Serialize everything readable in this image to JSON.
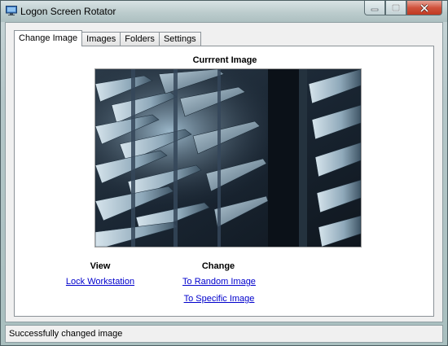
{
  "window": {
    "title": "Logon Screen Rotator"
  },
  "tabs": [
    {
      "label": "Change Image",
      "active": true
    },
    {
      "label": "Images",
      "active": false
    },
    {
      "label": "Folders",
      "active": false
    },
    {
      "label": "Settings",
      "active": false
    }
  ],
  "current_image": {
    "heading": "Currrent Image"
  },
  "view": {
    "heading": "View",
    "lock_link": "Lock Workstation"
  },
  "change": {
    "heading": "Change",
    "random_link": "To Random Image",
    "specific_link": "To Specific Image"
  },
  "status": {
    "text": "Successfully changed image"
  },
  "icons": {
    "app": "monitor-icon",
    "minimize": "minimize-icon",
    "maximize": "maximize-icon",
    "close": "close-icon"
  },
  "colors": {
    "link": "#0000cc",
    "close_button": "#c8432b"
  }
}
